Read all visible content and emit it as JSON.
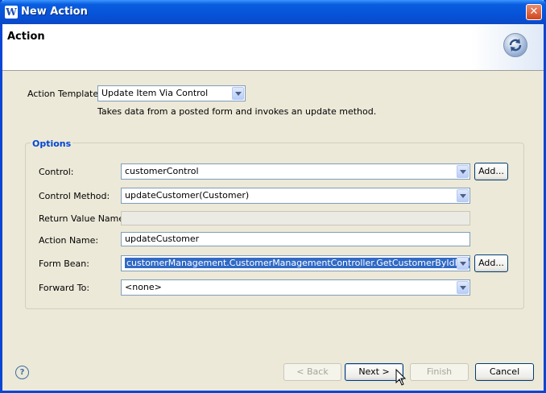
{
  "window": {
    "title": "New Action",
    "close_glyph": "✕",
    "app_icon": "W"
  },
  "banner": {
    "title": "Action",
    "icon": "refresh-gear-icon"
  },
  "template": {
    "label": "Action Template:",
    "value": "Update Item Via Control",
    "description": "Takes data from a posted form and invokes an update method."
  },
  "options": {
    "title": "Options",
    "control_label": "Control:",
    "control_value": "customerControl",
    "control_add": "Add...",
    "method_label": "Control Method:",
    "method_value": "updateCustomer(Customer)",
    "return_label": "Return Value Name:",
    "return_value": "",
    "action_name_label": "Action Name:",
    "action_name_value": "updateCustomer",
    "form_bean_label": "Form Bean:",
    "form_bean_value": "customerManagement.CustomerManagementController.GetCustomerByIdFormBean",
    "form_bean_add": "Add...",
    "forward_label": "Forward To:",
    "forward_value": "<none>"
  },
  "footer": {
    "help_glyph": "?",
    "back": "< Back",
    "next": "Next >",
    "finish": "Finish",
    "cancel": "Cancel"
  },
  "colors": {
    "title_bar": "#0a5ddf",
    "accent": "#0046d5",
    "selection": "#316ac5"
  }
}
